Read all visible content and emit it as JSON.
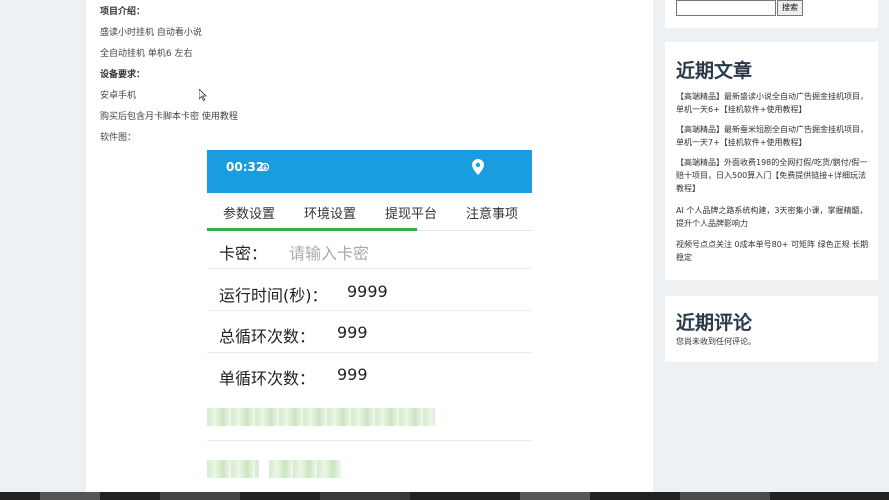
{
  "article": {
    "lines": [
      {
        "text": "项目介绍：",
        "bold": true
      },
      {
        "text": "盛读小时挂机 自动看小说",
        "bold": false
      },
      {
        "text": "全自动挂机 单机6 左右",
        "bold": false
      },
      {
        "text": "设备要求：",
        "bold": true
      },
      {
        "text": "安卓手机",
        "bold": false
      },
      {
        "text": "购买后包含月卡脚本卡密 使用教程",
        "bold": false
      },
      {
        "text": "软件图：",
        "bold": false
      }
    ]
  },
  "phone": {
    "time": "00:32",
    "tabs": [
      "参数设置",
      "环境设置",
      "提现平台",
      "注意事项"
    ],
    "card_label": "卡密：",
    "card_placeholder": "请输入卡密",
    "rows": [
      {
        "label": "运行时间(秒)：",
        "value": "9999"
      },
      {
        "label": "总循环次数：",
        "value": "999"
      },
      {
        "label": "单循环次数：",
        "value": "999"
      }
    ]
  },
  "sidebar": {
    "search_button": "搜索",
    "recent_posts_title": "近期文章",
    "recent_posts": [
      "【高端精品】最新盛读小说全自动广告掘金挂机项目，单机一天6+【挂机软件+使用教程】",
      "【高端精品】最新蚕米短剧全自动广告掘金挂机项目，单机一天7+【挂机软件+使用教程】",
      "【高端精品】外面收费198的全网打假/吃货/鹅付/假一赔十项目，日入500算入门【免费提供链接+详细玩法教程】",
      "AI 个人品牌之路系统构建，3天密集小课，掌握精髓，提升个人品牌影响力",
      "视频号点点关注 0成本单号80+ 可矩阵 绿色正规 长期稳定"
    ],
    "recent_comments_title": "近期评论",
    "no_comments": "您尚未收到任何评论。"
  },
  "colors": {
    "statusbar": "#1a9de0",
    "tab_accent": "#2fb24b",
    "title": "#2a3a4a"
  }
}
